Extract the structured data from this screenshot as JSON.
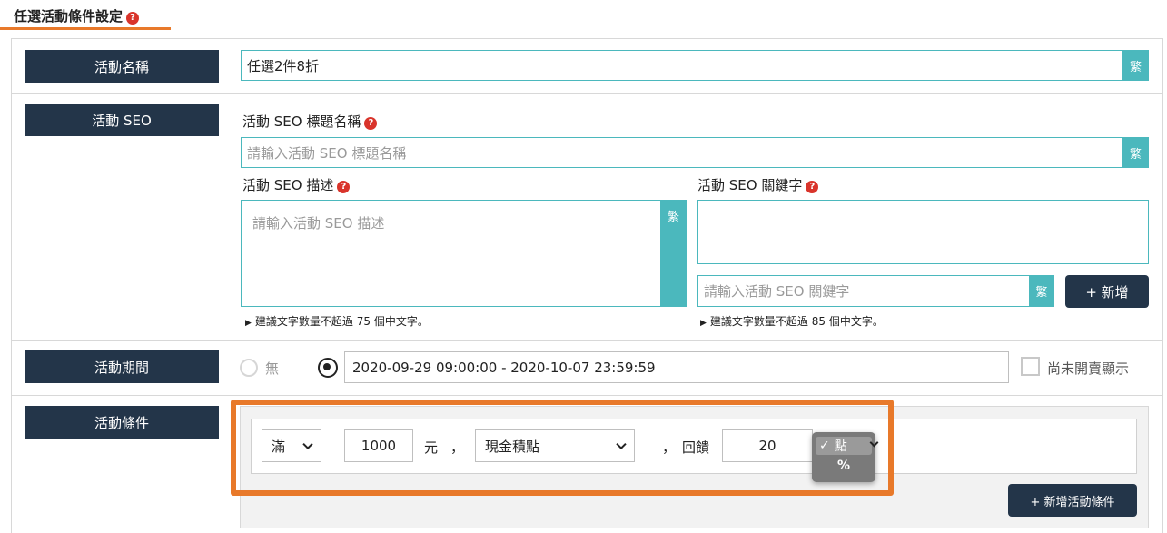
{
  "section": {
    "title": "任選活動條件設定",
    "help": "?"
  },
  "lang_button": "繁",
  "name_row": {
    "label": "活動名稱",
    "value": "任選2件8折"
  },
  "seo_row": {
    "label": "活動 SEO",
    "title_label": "活動 SEO 標題名稱",
    "title_placeholder": "請輸入活動 SEO 標題名稱",
    "desc_label": "活動 SEO 描述",
    "desc_placeholder": "請輸入活動 SEO 描述",
    "desc_hint": "建議文字數量不超過 75 個中文字。",
    "keyword_label": "活動 SEO 關鍵字",
    "keyword_placeholder": "請輸入活動 SEO 關鍵字",
    "keyword_add": "+ 新增",
    "keyword_hint": "建議文字數量不超過 85 個中文字。"
  },
  "period_row": {
    "label": "活動期間",
    "option_none": "無",
    "range_value": "2020-09-29 09:00:00 - 2020-10-07 23:59:59",
    "not_open_label": "尚未開賣顯示"
  },
  "condition_row": {
    "label": "活動條件",
    "compare_select": "滿",
    "amount": "1000",
    "currency": "元",
    "comma1": "，",
    "reward_type_select": "現金積點",
    "comma2": "，",
    "reward_label": "回饋",
    "reward_value": "20",
    "unit_options": {
      "selected": "點",
      "other": "%"
    },
    "add_condition": "+ 新增活動條件"
  },
  "colors": {
    "navy": "#233549",
    "teal": "#4bb8bd",
    "orange": "#e8792a",
    "help_red": "#d9342b"
  }
}
